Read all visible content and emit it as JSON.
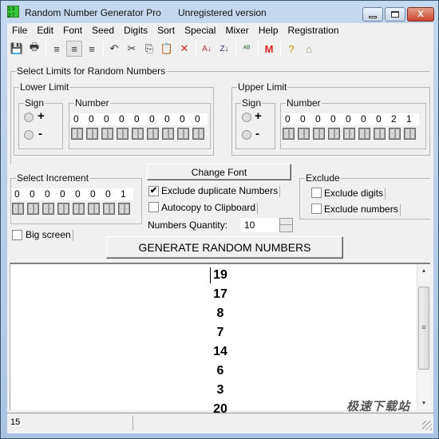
{
  "window": {
    "title": "Random Number Generator Pro",
    "registration_status": "Unregistered version",
    "controls": {
      "minimize": "minimize",
      "maximize": "maximize",
      "close": "X"
    }
  },
  "menu": [
    "File",
    "Edit",
    "Font",
    "Seed",
    "Digits",
    "Sort",
    "Special",
    "Mixer",
    "Help",
    "Registration"
  ],
  "toolbar": [
    {
      "name": "save-icon",
      "glyph": "💾"
    },
    {
      "name": "print-icon",
      "glyph": "🖶"
    },
    {
      "sep": true
    },
    {
      "name": "align-left-icon",
      "glyph": "≡"
    },
    {
      "name": "align-center-icon",
      "glyph": "≡"
    },
    {
      "name": "align-right-icon",
      "glyph": "≡"
    },
    {
      "sep": true
    },
    {
      "name": "undo-icon",
      "glyph": "↶"
    },
    {
      "name": "cut-icon",
      "glyph": "✂"
    },
    {
      "name": "copy-icon",
      "glyph": "⎘"
    },
    {
      "name": "paste-icon",
      "glyph": "📋"
    },
    {
      "name": "delete-icon",
      "glyph": "✕"
    },
    {
      "sep": true
    },
    {
      "name": "sort-ascending-icon",
      "glyph": "A↓"
    },
    {
      "name": "sort-descending-icon",
      "glyph": "Z↓"
    },
    {
      "sep": true
    },
    {
      "name": "mixer-icon",
      "glyph": "ᴬᴮ"
    },
    {
      "sep": true
    },
    {
      "name": "m-icon",
      "glyph": "M"
    },
    {
      "sep": true
    },
    {
      "name": "help-icon",
      "glyph": "?"
    },
    {
      "name": "home-icon",
      "glyph": "⌂"
    }
  ],
  "limits": {
    "title": "Select Limits for Random Numbers",
    "lower": {
      "title": "Lower Limit",
      "sign_title": "Sign",
      "plus": "+",
      "minus": "-",
      "number_title": "Number",
      "digits": [
        "0",
        "0",
        "0",
        "0",
        "0",
        "0",
        "0",
        "0",
        "0"
      ]
    },
    "upper": {
      "title": "Upper Limit",
      "sign_title": "Sign",
      "plus": "+",
      "minus": "-",
      "number_title": "Number",
      "digits": [
        "0",
        "0",
        "0",
        "0",
        "0",
        "0",
        "0",
        "2",
        "1"
      ]
    }
  },
  "increment": {
    "title": "Select Increment",
    "digits": [
      "0",
      "0",
      "0",
      "0",
      "0",
      "0",
      "0",
      "1"
    ]
  },
  "options": {
    "change_font": "Change Font",
    "exclude_duplicates": {
      "label": "Exclude duplicate Numbers",
      "checked": true
    },
    "autocopy": {
      "label": "Autocopy to Clipboard",
      "checked": false
    },
    "quantity_label": "Numbers Quantity:",
    "quantity_value": "10",
    "big_screen": {
      "label": "Big screen",
      "checked": false
    }
  },
  "exclude": {
    "title": "Exclude",
    "digits": {
      "label": "Exclude digits",
      "checked": false
    },
    "numbers": {
      "label": "Exclude numbers",
      "checked": false
    }
  },
  "generate_button": "GENERATE RANDOM NUMBERS",
  "output": {
    "numbers": [
      "19",
      "17",
      "8",
      "7",
      "14",
      "6",
      "3",
      "20"
    ]
  },
  "status": {
    "count": "15"
  },
  "watermark": "极速下载站"
}
